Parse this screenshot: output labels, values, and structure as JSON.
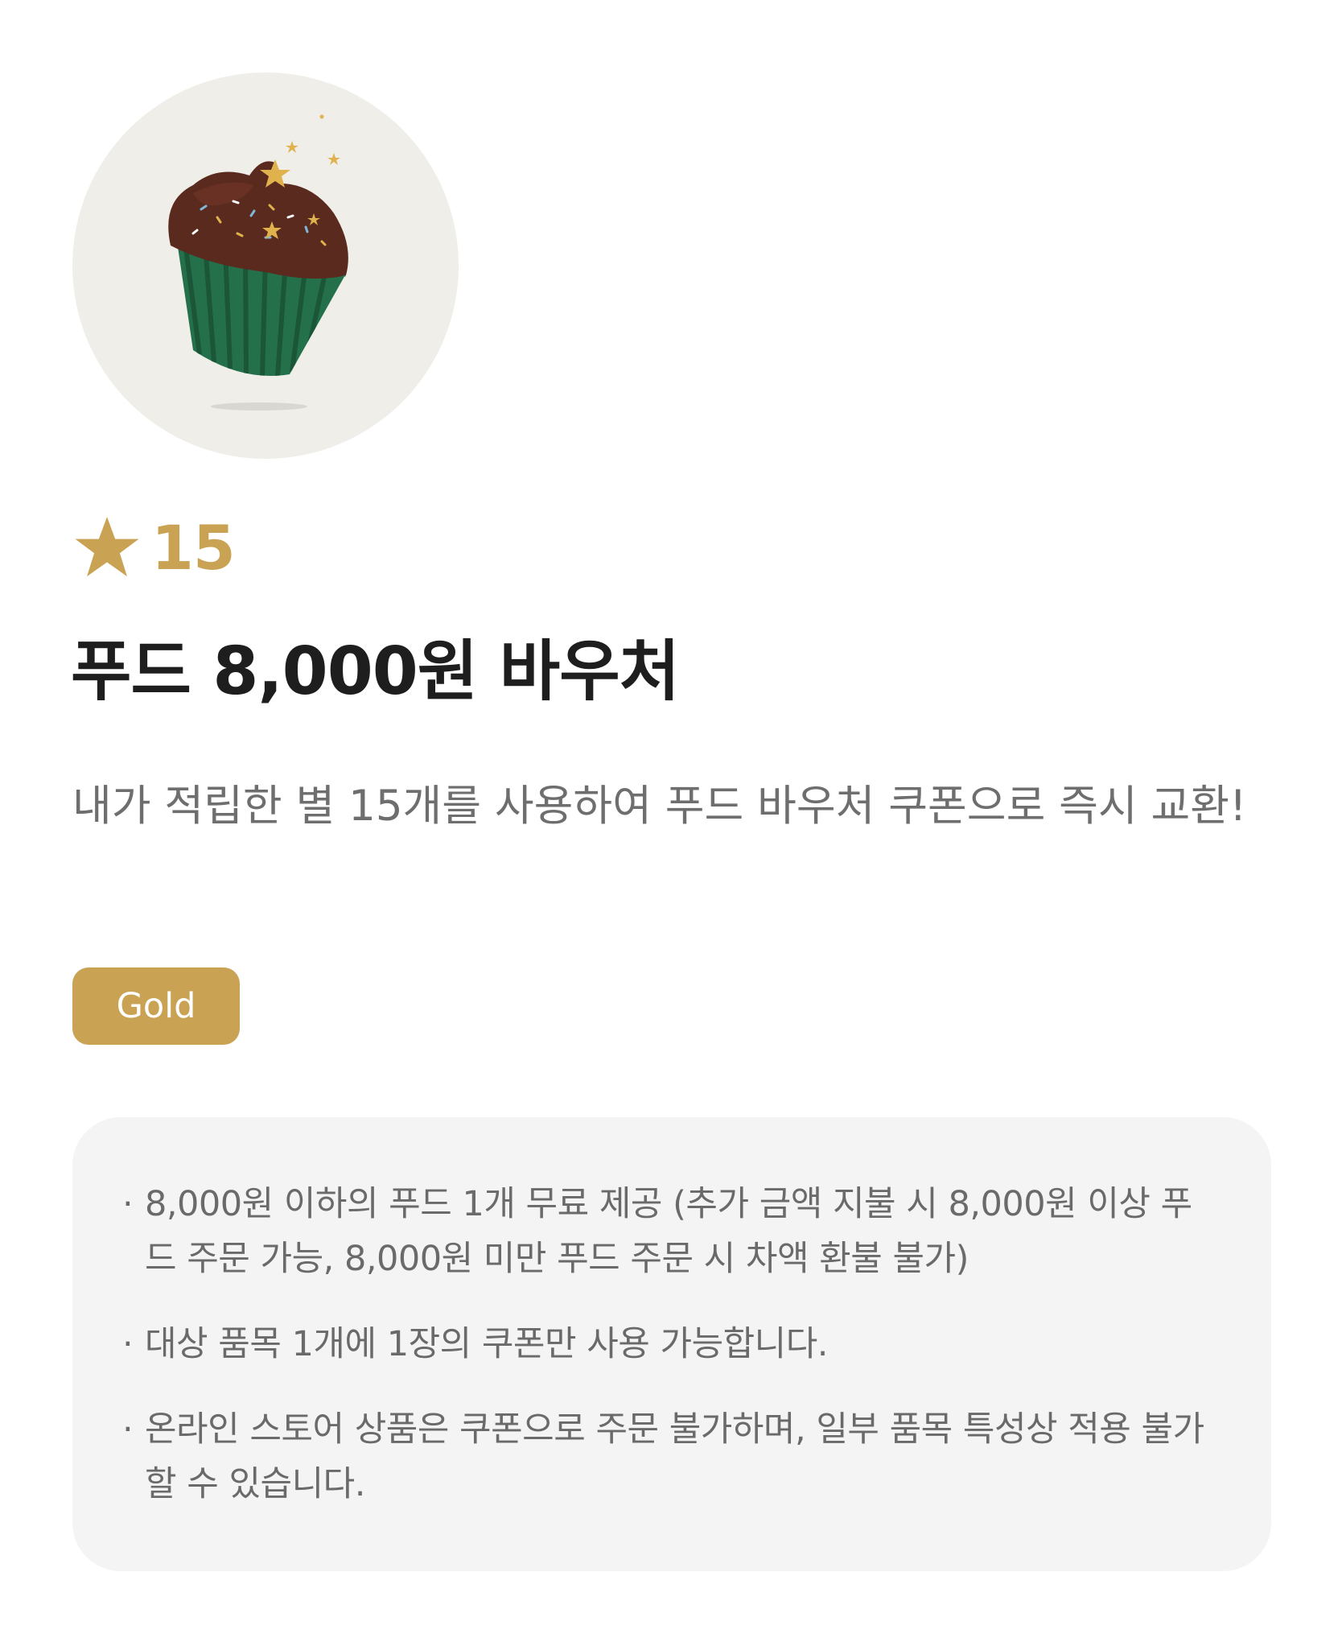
{
  "hero_image": {
    "name": "chocolate-cupcake-illustration",
    "colors": {
      "circle_background": "#efeee9",
      "frosting": "#5a2a1e",
      "wrapper": "#24704a",
      "sparkle": "#e0b24e"
    }
  },
  "price": {
    "icon": "star-icon",
    "value": "15",
    "color": "#c9a253"
  },
  "title": "푸드 8,000원 바우처",
  "description": "내가 적립한 별 15개를 사용하여 푸드 바우처 쿠폰으로 즉시 교환!",
  "tier_badge": {
    "label": "Gold",
    "color": "#c9a253"
  },
  "notices": [
    {
      "bullet": "·",
      "text": "8,000원 이하의 푸드 1개 무료 제공 (추가 금액 지불 시 8,000원 이상 푸드 주문 가능, 8,000원 미만 푸드 주문 시 차액 환불 불가)"
    },
    {
      "bullet": "·",
      "text": "대상 품목 1개에 1장의 쿠폰만 사용 가능합니다."
    },
    {
      "bullet": "·",
      "text": "온라인 스토어 상품은 쿠폰으로 주문 불가하며, 일부 품목 특성상 적용 불가할 수 있습니다."
    }
  ]
}
